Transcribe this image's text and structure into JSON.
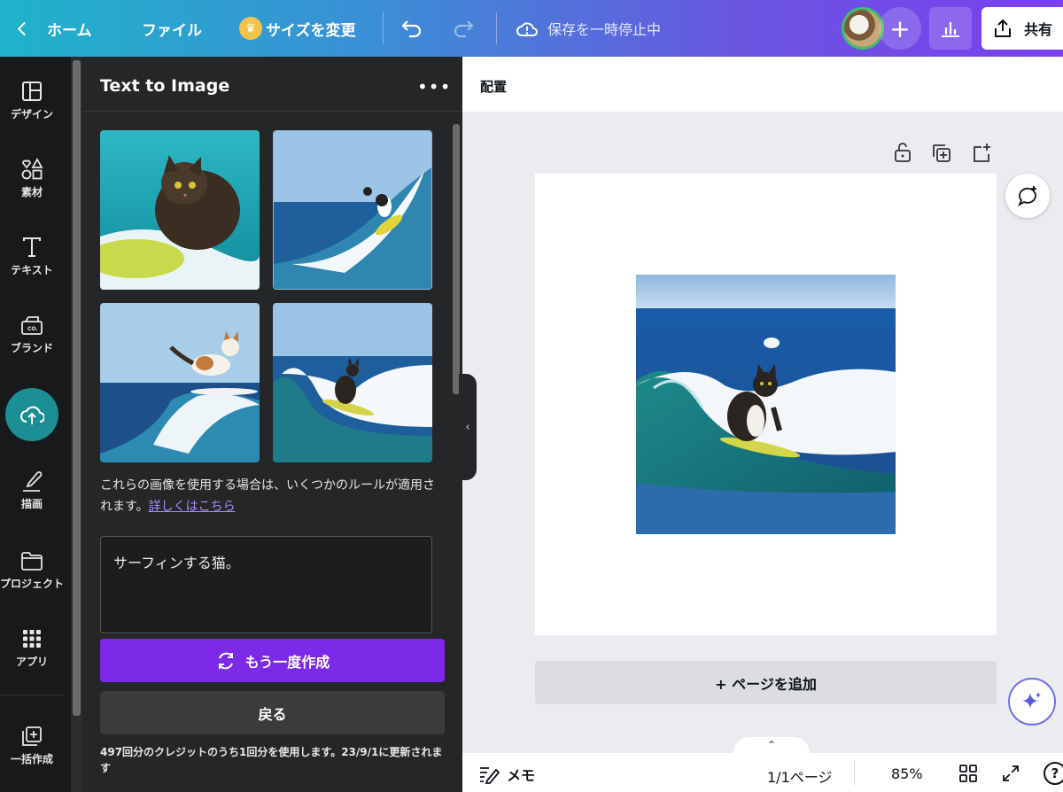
{
  "topbar": {
    "home_label": "ホーム",
    "file_label": "ファイル",
    "resize_label": "サイズを変更",
    "save_status": "保存を一時停止中",
    "share_label": "共有"
  },
  "rail": {
    "items": [
      {
        "label": "デザイン",
        "icon": "layout-icon"
      },
      {
        "label": "素材",
        "icon": "shapes-icon"
      },
      {
        "label": "テキスト",
        "icon": "text-icon"
      },
      {
        "label": "ブランド",
        "icon": "brand-icon"
      },
      {
        "label": "アップロード",
        "icon": "upload-cloud-icon"
      },
      {
        "label": "描画",
        "icon": "draw-icon"
      },
      {
        "label": "プロジェクト",
        "icon": "folder-icon"
      },
      {
        "label": "アプリ",
        "icon": "apps-grid-icon"
      },
      {
        "label": "一括作成",
        "icon": "bulk-create-icon"
      }
    ]
  },
  "panel": {
    "title": "Text to Image",
    "rules_text": "これらの画像を使用する場合は、いくつかのルールが適用されます。",
    "rules_link": "詳しくはこちら",
    "prompt_value": "サーフィンする猫。",
    "regenerate_label": "もう一度作成",
    "back_label": "戻る",
    "credits_text": "497回分のクレジットのうち1回分を使用します。23/9/1に更新されます"
  },
  "editor": {
    "arrange_label": "配置",
    "add_page_label": "+ ページを追加"
  },
  "bottombar": {
    "notes_label": "メモ",
    "pages_label": "1/1ページ",
    "zoom_label": "85%"
  },
  "colors": {
    "accent_purple": "#7d2ae8",
    "upload_teal": "#1b8f93",
    "panel_bg": "#252627"
  }
}
